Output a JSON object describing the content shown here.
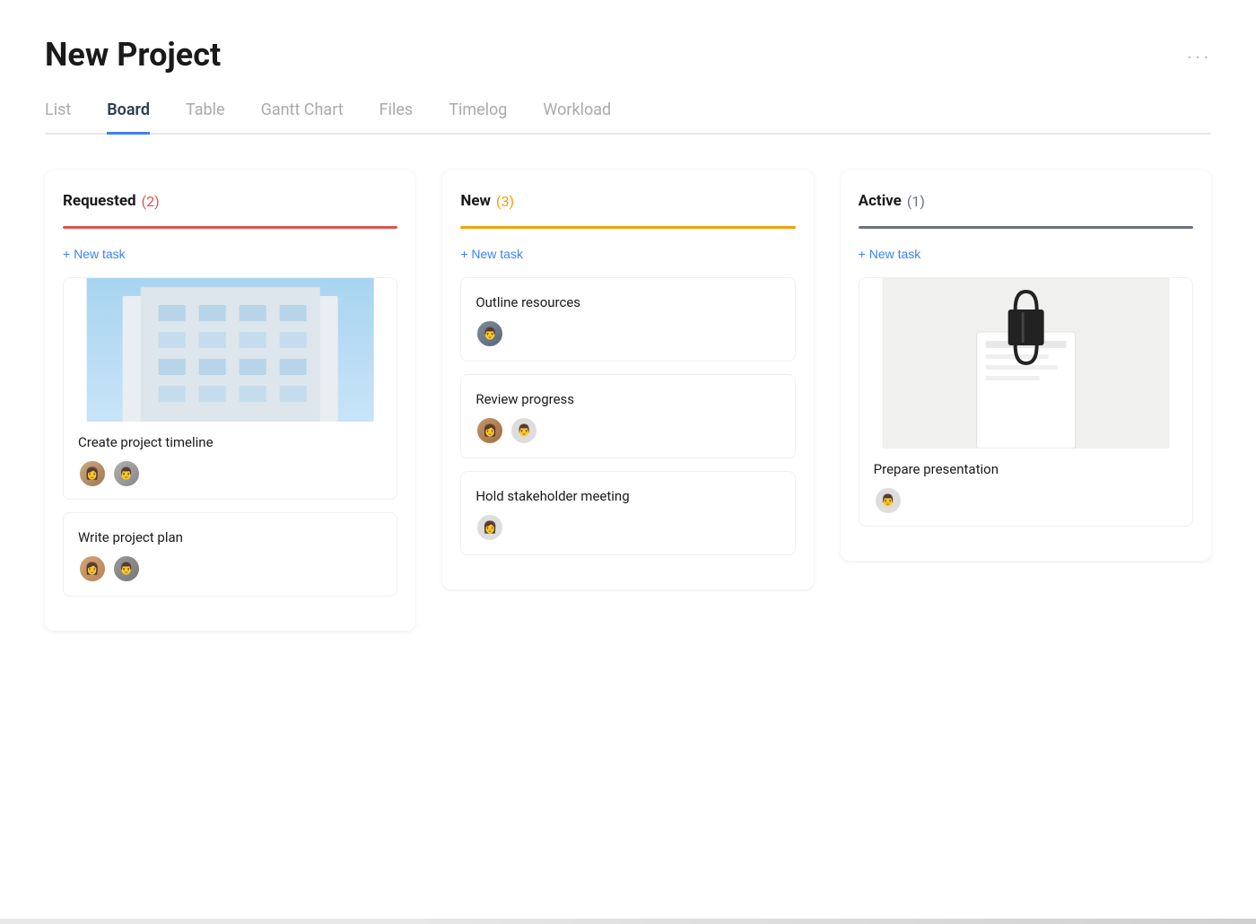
{
  "page": {
    "title": "New Project",
    "moreIcon": "···"
  },
  "tabs": [
    {
      "label": "List"
    },
    {
      "label": "Board"
    },
    {
      "label": "Table"
    },
    {
      "label": "Gantt Chart"
    },
    {
      "label": "Files"
    },
    {
      "label": "Timelog"
    },
    {
      "label": "Workload"
    }
  ],
  "columns": [
    {
      "title": "Requested",
      "count": "(2)",
      "newTaskLabel": "+ New task",
      "cards": [
        {
          "title": "Create project timeline",
          "hasImage": true,
          "avatars": [
            "woman",
            "man-glasses"
          ]
        },
        {
          "title": "Write project plan",
          "hasImage": false,
          "avatars": [
            "woman2",
            "man2"
          ]
        }
      ]
    },
    {
      "title": "New",
      "count": "(3)",
      "newTaskLabel": "+ New task",
      "cards": [
        {
          "title": "Outline resources",
          "hasImage": false,
          "avatars": [
            "man3"
          ]
        },
        {
          "title": "Review progress",
          "hasImage": false,
          "avatars": [
            "woman3",
            "man-dark"
          ]
        },
        {
          "title": "Hold stakeholder meeting",
          "hasImage": false,
          "avatars": [
            "woman4"
          ]
        }
      ]
    },
    {
      "title": "Active",
      "count": "(1)",
      "newTaskLabel": "+ New task",
      "cards": [
        {
          "title": "Prepare presentation",
          "hasImage": true,
          "avatars": [
            "man-glasses2"
          ]
        }
      ]
    }
  ]
}
